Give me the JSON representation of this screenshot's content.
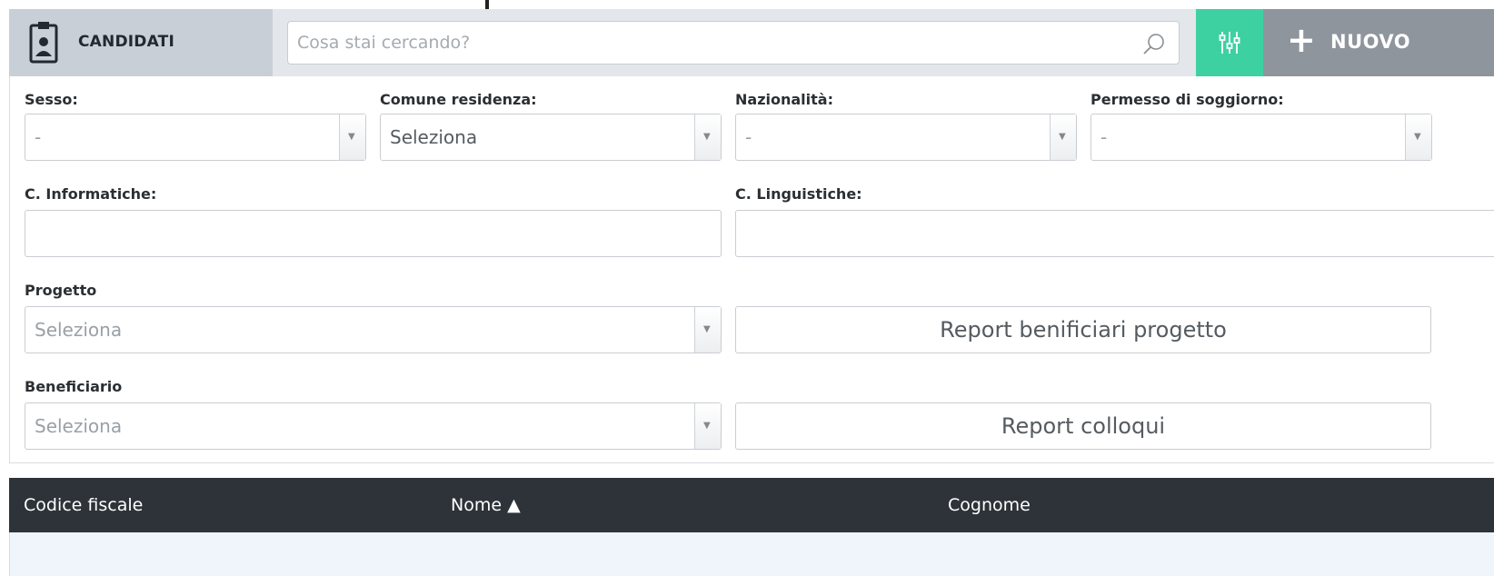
{
  "header": {
    "module_title": "CANDIDATI",
    "search_placeholder": "Cosa stai cercando?",
    "new_label": "NUOVO",
    "new_plus": "+"
  },
  "filters": {
    "sesso": {
      "label": "Sesso:",
      "value": "-"
    },
    "comune": {
      "label": "Comune residenza:",
      "value": "Seleziona"
    },
    "nazionalita": {
      "label": "Nazionalità:",
      "value": "-"
    },
    "permesso": {
      "label": "Permesso di soggiorno:",
      "value": "-"
    },
    "informatiche": {
      "label": "C. Informatiche:"
    },
    "linguistiche": {
      "label": "C. Linguistiche:"
    },
    "progetto": {
      "label": "Progetto",
      "value": "Seleziona"
    },
    "beneficiario": {
      "label": "Beneficiario",
      "value": "Seleziona"
    }
  },
  "buttons": {
    "report_progetto": "Report benificiari progetto",
    "report_colloqui": "Report colloqui"
  },
  "table": {
    "columns": [
      "Codice fiscale",
      "Nome ▲",
      "Cognome"
    ]
  },
  "colors": {
    "accent": "#3dd1a2",
    "header_bg": "#2d3339",
    "new_btn": "#8f959c"
  },
  "icons": {
    "module": "clipboard-person-icon",
    "search": "search-icon",
    "filter": "sliders-icon",
    "dropdown": "caret-down-icon"
  }
}
